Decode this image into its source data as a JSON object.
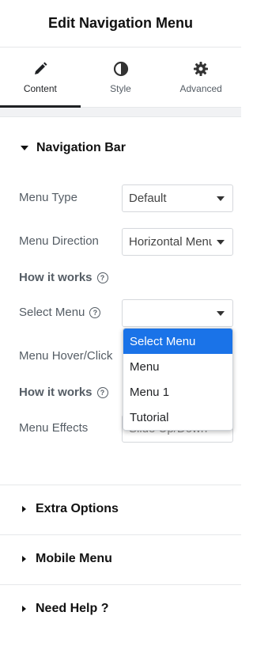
{
  "header": {
    "title": "Edit Navigation Menu"
  },
  "tabs": [
    {
      "label": "Content",
      "icon": "pencil-icon",
      "active": true
    },
    {
      "label": "Style",
      "icon": "contrast-icon",
      "active": false
    },
    {
      "label": "Advanced",
      "icon": "gear-icon",
      "active": false
    }
  ],
  "nav_section": {
    "title": "Navigation Bar",
    "menu_type": {
      "label": "Menu Type",
      "value": "Default"
    },
    "menu_direction": {
      "label": "Menu Direction",
      "value": "Horizontal Menu"
    },
    "how_it_works_1": "How it works",
    "select_menu": {
      "label": "Select Menu",
      "value": ""
    },
    "menu_hover": {
      "label": "Menu Hover/Click"
    },
    "how_it_works_2": "How it works",
    "menu_effects": {
      "label": "Menu Effects",
      "value": "Slide Up/Down"
    }
  },
  "dropdown": {
    "options": [
      "Select Menu",
      "Menu",
      "Menu 1",
      "Tutorial"
    ],
    "selected_index": 0
  },
  "sections": {
    "extra_options": "Extra Options",
    "mobile_menu": "Mobile Menu",
    "need_help": "Need Help ?"
  },
  "colors": {
    "accent": "#1a73e8",
    "text": "#1f2124",
    "muted": "#555d65"
  }
}
